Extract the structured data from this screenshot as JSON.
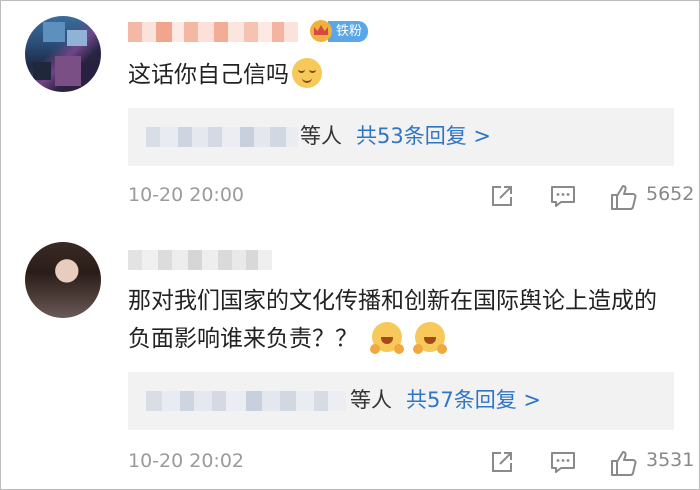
{
  "comments": [
    {
      "badge": "铁粉",
      "text": "这话你自己信吗",
      "emoji": [
        "relieved-face-emoji"
      ],
      "reply_others": "等人",
      "reply_link": "共53条回复 >",
      "timestamp": "10-20 20:00",
      "likes": "5652"
    },
    {
      "text": "那对我们国家的文化传播和创新在国际舆论上造成的负面影响谁来负责？？",
      "emoji": [
        "hugging-face-emoji",
        "hugging-face-emoji"
      ],
      "reply_others": "等人",
      "reply_link": "共57条回复 >",
      "timestamp": "10-20 20:02",
      "likes": "3531"
    }
  ],
  "icons": {
    "share": "share-icon",
    "comment": "comment-icon",
    "like": "thumbs-up-icon"
  },
  "colors": {
    "link": "#2f75c6",
    "meta": "#9b9b9b",
    "reply_bg": "#f2f2f2",
    "badge": "#5aa6e8"
  }
}
